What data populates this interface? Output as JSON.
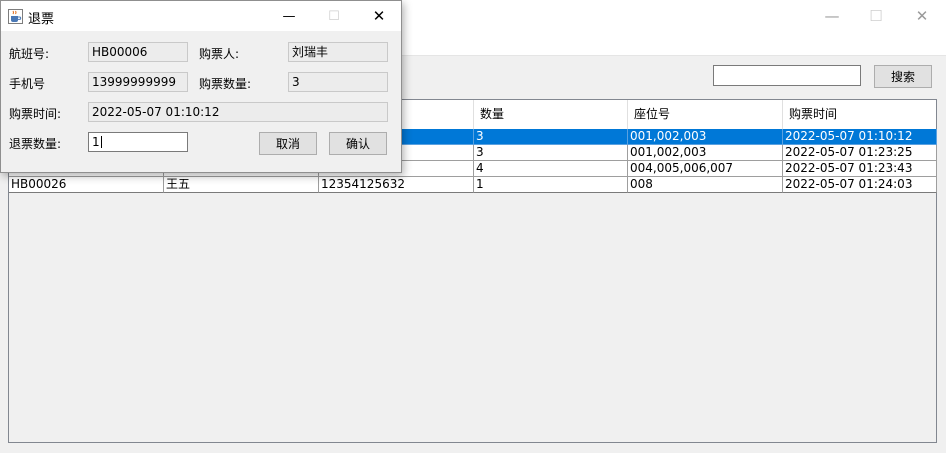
{
  "main_window": {
    "controls": {
      "minimize": "—",
      "maximize": "☐",
      "close": "✕"
    },
    "search": {
      "value": "",
      "button_label": "搜索"
    },
    "table": {
      "columns": [
        "",
        "",
        "",
        "数量",
        "座位号",
        "购票时间"
      ],
      "rows": [
        {
          "flight": "",
          "name": "",
          "phone": "",
          "qty": "3",
          "seats": "001,002,003",
          "time": "2022-05-07 01:10:12",
          "selected": true
        },
        {
          "flight": "",
          "name": "",
          "phone": "",
          "qty": "3",
          "seats": "001,002,003",
          "time": "2022-05-07 01:23:25",
          "selected": false
        },
        {
          "flight": "",
          "name": "",
          "phone": "",
          "qty": "4",
          "seats": "004,005,006,007",
          "time": "2022-05-07 01:23:43",
          "selected": false
        },
        {
          "flight": "HB00026",
          "name": "王五",
          "phone": "12354125632",
          "qty": "1",
          "seats": "008",
          "time": "2022-05-07 01:24:03",
          "selected": false
        }
      ]
    }
  },
  "dialog": {
    "title": "退票",
    "controls": {
      "minimize": "—",
      "maximize": "☐",
      "close": "✕"
    },
    "flight_label": "航班号:",
    "flight_value": "HB00006",
    "buyer_label": "购票人:",
    "buyer_value": "刘瑞丰",
    "phone_label": "手机号",
    "phone_value": "13999999999",
    "qty_label": "购票数量:",
    "qty_value": "3",
    "time_label": "购票时间:",
    "time_value": "2022-05-07 01:10:12",
    "refund_qty_label": "退票数量:",
    "refund_qty_value": "1",
    "cancel_label": "取消",
    "confirm_label": "确认"
  },
  "colors": {
    "selection": "#0078d7",
    "dialog_bg": "#f0f0f0",
    "button_bg": "#e1e1e1"
  },
  "icons": {
    "app": "java-coffee-icon"
  }
}
